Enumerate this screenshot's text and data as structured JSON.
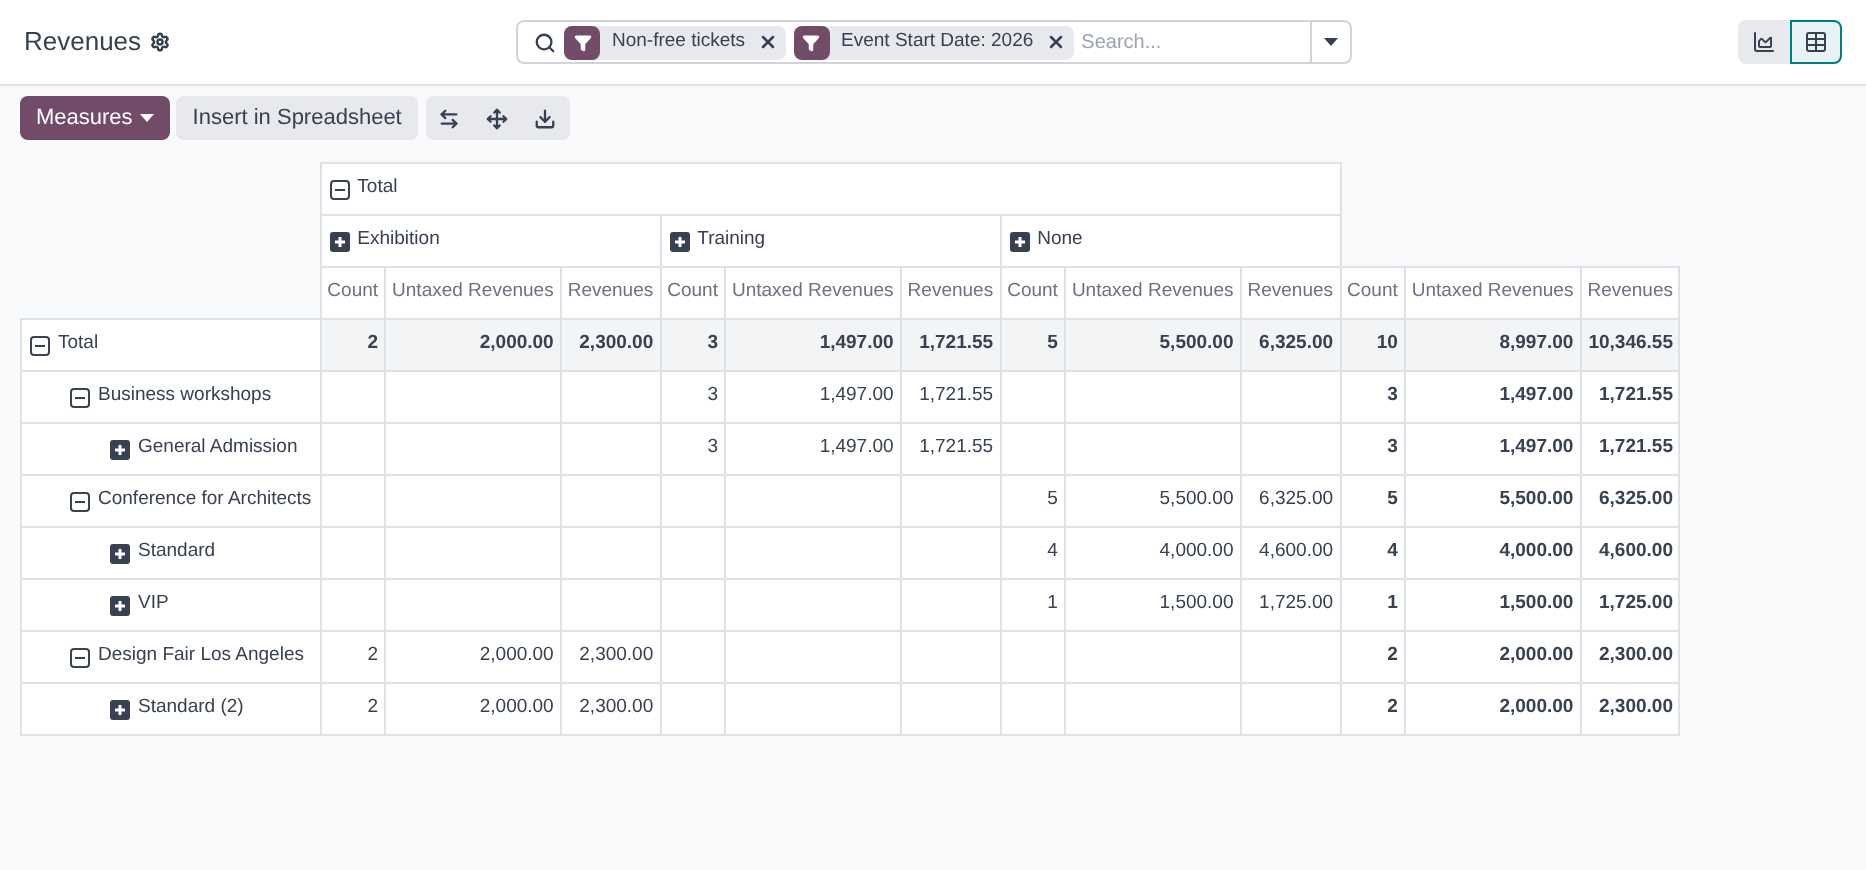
{
  "page": {
    "title": "Revenues"
  },
  "search": {
    "facets": [
      {
        "label": "Non-free tickets"
      },
      {
        "label": "Event Start Date: 2026"
      }
    ],
    "placeholder": "Search..."
  },
  "view_switcher": [
    {
      "kind": "graph",
      "selected": false
    },
    {
      "kind": "pivot",
      "selected": true
    }
  ],
  "toolbar": {
    "measures": "Measures",
    "insert": "Insert in Spreadsheet"
  },
  "pivot": {
    "column_header": {
      "label": "Total",
      "expanded": true,
      "children": [
        {
          "label": "Exhibition",
          "expanded": false
        },
        {
          "label": "Training",
          "expanded": false
        },
        {
          "label": "None",
          "expanded": false
        }
      ]
    },
    "measure_headers": [
      "Count",
      "Untaxed Revenues",
      "Revenues",
      "Count",
      "Untaxed Revenues",
      "Revenues",
      "Count",
      "Untaxed Revenues",
      "Revenues",
      "Count",
      "Untaxed Revenues",
      "Revenues"
    ],
    "rows": [
      {
        "label": "Total",
        "expanded": true,
        "exhibition": [
          "2",
          "2,000.00",
          "2,300.00"
        ],
        "training": [
          "3",
          "1,497.00",
          "1,721.55"
        ],
        "none": [
          "5",
          "5,500.00",
          "6,325.00"
        ],
        "total": [
          "10",
          "8,997.00",
          "10,346.55"
        ],
        "children": [
          {
            "label": "Business workshops",
            "expanded": true,
            "training": [
              "3",
              "1,497.00",
              "1,721.55"
            ],
            "total": [
              "3",
              "1,497.00",
              "1,721.55"
            ],
            "children": [
              {
                "label": "General Admission",
                "expanded": false,
                "training": [
                  "3",
                  "1,497.00",
                  "1,721.55"
                ],
                "total": [
                  "3",
                  "1,497.00",
                  "1,721.55"
                ]
              }
            ]
          },
          {
            "label": "Conference for Architects",
            "expanded": true,
            "none": [
              "5",
              "5,500.00",
              "6,325.00"
            ],
            "total": [
              "5",
              "5,500.00",
              "6,325.00"
            ],
            "children": [
              {
                "label": "Standard",
                "expanded": false,
                "none": [
                  "4",
                  "4,000.00",
                  "4,600.00"
                ],
                "total": [
                  "4",
                  "4,000.00",
                  "4,600.00"
                ]
              },
              {
                "label": "VIP",
                "expanded": false,
                "none": [
                  "1",
                  "1,500.00",
                  "1,725.00"
                ],
                "total": [
                  "1",
                  "1,500.00",
                  "1,725.00"
                ]
              }
            ]
          },
          {
            "label": "Design Fair Los Angeles",
            "expanded": true,
            "exhibition": [
              "2",
              "2,000.00",
              "2,300.00"
            ],
            "total": [
              "2",
              "2,000.00",
              "2,300.00"
            ],
            "children": [
              {
                "label": "Standard (2)",
                "expanded": false,
                "exhibition": [
                  "2",
                  "2,000.00",
                  "2,300.00"
                ],
                "total": [
                  "2",
                  "2,000.00",
                  "2,300.00"
                ]
              }
            ]
          }
        ]
      }
    ]
  }
}
